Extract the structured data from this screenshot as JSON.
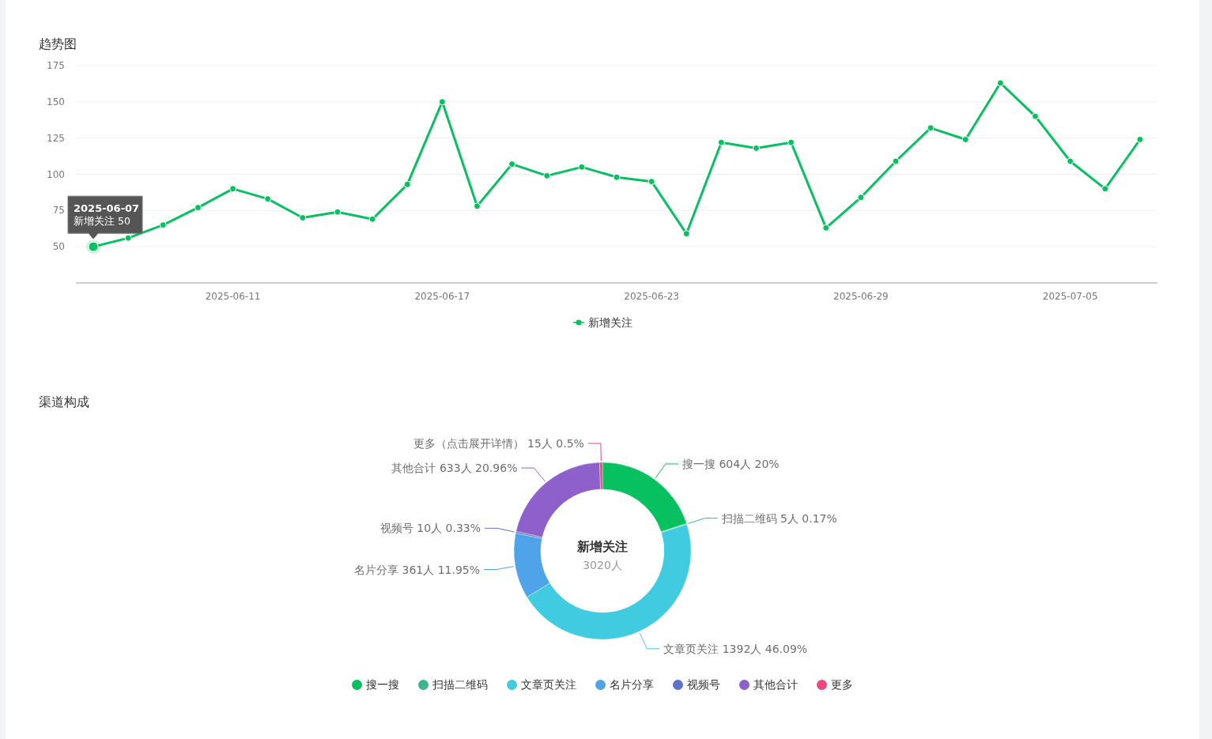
{
  "trend": {
    "title": "趋势图",
    "chart_data": {
      "type": "line",
      "categories": [
        null,
        null,
        null,
        null,
        "2025-06-11",
        null,
        null,
        null,
        null,
        null,
        "2025-06-17",
        null,
        null,
        null,
        null,
        null,
        "2025-06-23",
        null,
        null,
        null,
        null,
        null,
        "2025-06-29",
        null,
        null,
        null,
        null,
        null,
        "2025-07-05",
        null,
        null
      ],
      "grid": true,
      "series": [
        {
          "name": "新增关注",
          "color": "#07c160",
          "marker": "circle",
          "values": [
            50,
            56,
            65,
            77,
            90,
            83,
            70,
            74,
            69,
            93,
            150,
            78,
            107,
            99,
            105,
            98,
            95,
            59,
            122,
            118,
            122,
            63,
            84,
            109,
            132,
            124,
            163,
            140,
            109,
            90,
            124
          ]
        }
      ],
      "ylim": [
        25,
        175
      ],
      "yticks": [
        50,
        75,
        100,
        125,
        150,
        175
      ],
      "annotations": [
        "2025-06-07",
        "新增关注 50"
      ]
    }
  },
  "channels": {
    "title": "渠道构成",
    "center_title": "新增关注",
    "center_value": "3020人",
    "chart_data": {
      "type": "donut",
      "categories": [
        "搜一搜",
        "扫描二维码",
        "文章页关注",
        "名片分享",
        "视频号",
        "其他合计",
        "更多"
      ],
      "values": [
        604,
        5,
        1392,
        361,
        10,
        633,
        15
      ],
      "colors": [
        "#07c160",
        "#3db58a",
        "#40cbe0",
        "#4fa3e8",
        "#5e72cc",
        "#8e60cc",
        "#f0457e"
      ],
      "value_labels": [
        "搜一搜 604人 20%",
        "扫描二维码 5人 0.17%",
        "文章页关注 1392人 46.09%",
        "名片分享 361人 11.95%",
        "视频号 10人 0.33%",
        "其他合计 633人 20.96%",
        "更多（点击展开详情） 15人 0.5%"
      ]
    }
  }
}
